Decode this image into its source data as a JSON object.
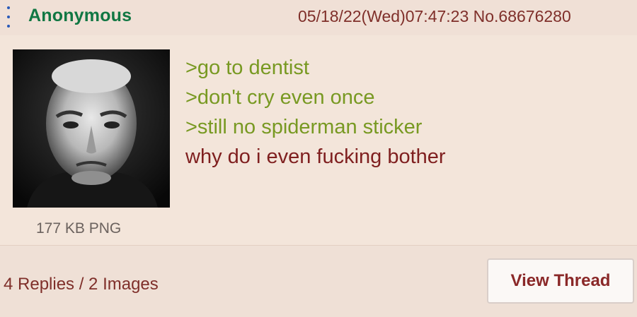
{
  "header": {
    "menu_icon": "vertical-dots-icon",
    "name": "Anonymous",
    "meta": "05/18/22(Wed)07:47:23 No.68676280"
  },
  "post": {
    "image_description": "black and white portrait of a frowning bald man",
    "file_info": "177 KB PNG",
    "lines": [
      {
        "text": ">go to dentist",
        "type": "greentext"
      },
      {
        "text": ">don't cry even once",
        "type": "greentext"
      },
      {
        "text": ">still no spiderman sticker",
        "type": "greentext"
      },
      {
        "text": "why do i even fucking bother",
        "type": "normal"
      }
    ]
  },
  "footer": {
    "replies": "4 Replies / 2 Images",
    "view_thread_label": "View Thread"
  },
  "colors": {
    "background": "#f0e0d6",
    "name_green": "#117743",
    "greentext": "#789922",
    "text_red": "#7f1f1f",
    "link_blue": "#2a59b8"
  }
}
